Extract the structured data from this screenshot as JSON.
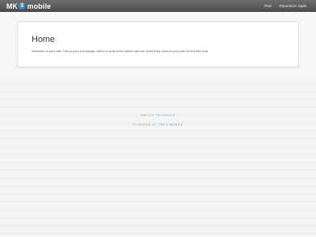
{
  "header": {
    "brand": {
      "prefix": "MK",
      "badge": "3",
      "suffix": "mobile"
    },
    "nav": [
      "iPad",
      "Réparation Apple"
    ]
  },
  "page": {
    "title": "Home",
    "intro": "Welcome to your site! This is your homepage, which is what most visitors will see when they come to your site for the first time."
  },
  "footer": {
    "link": "SWITCH TO MOBILE",
    "powered_prefix": "POWERED BY",
    "powered_name": "THE 3 MOBILE"
  },
  "colors": {
    "brand_badge": "#2b8fd6",
    "topbar": "#5a5a5a",
    "background": "#f2f2f2"
  }
}
